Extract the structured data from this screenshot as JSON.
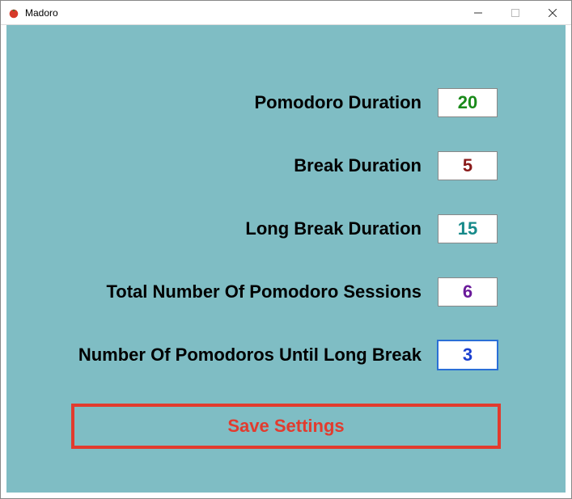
{
  "window": {
    "title": "Madoro",
    "icon": "tomato-icon"
  },
  "settings": {
    "pomodoro_duration": {
      "label": "Pomodoro Duration",
      "value": "20",
      "color": "green"
    },
    "break_duration": {
      "label": "Break Duration",
      "value": "5",
      "color": "darkred"
    },
    "long_break_duration": {
      "label": "Long Break Duration",
      "value": "15",
      "color": "teal"
    },
    "total_sessions": {
      "label": "Total Number Of Pomodoro Sessions",
      "value": "6",
      "color": "purple"
    },
    "until_long_break": {
      "label": "Number Of Pomodoros Until Long Break",
      "value": "3",
      "color": "blue",
      "focused": true
    }
  },
  "actions": {
    "save_label": "Save Settings"
  },
  "colors": {
    "background": "#7fbdc4",
    "accent": "#e23b2e"
  }
}
